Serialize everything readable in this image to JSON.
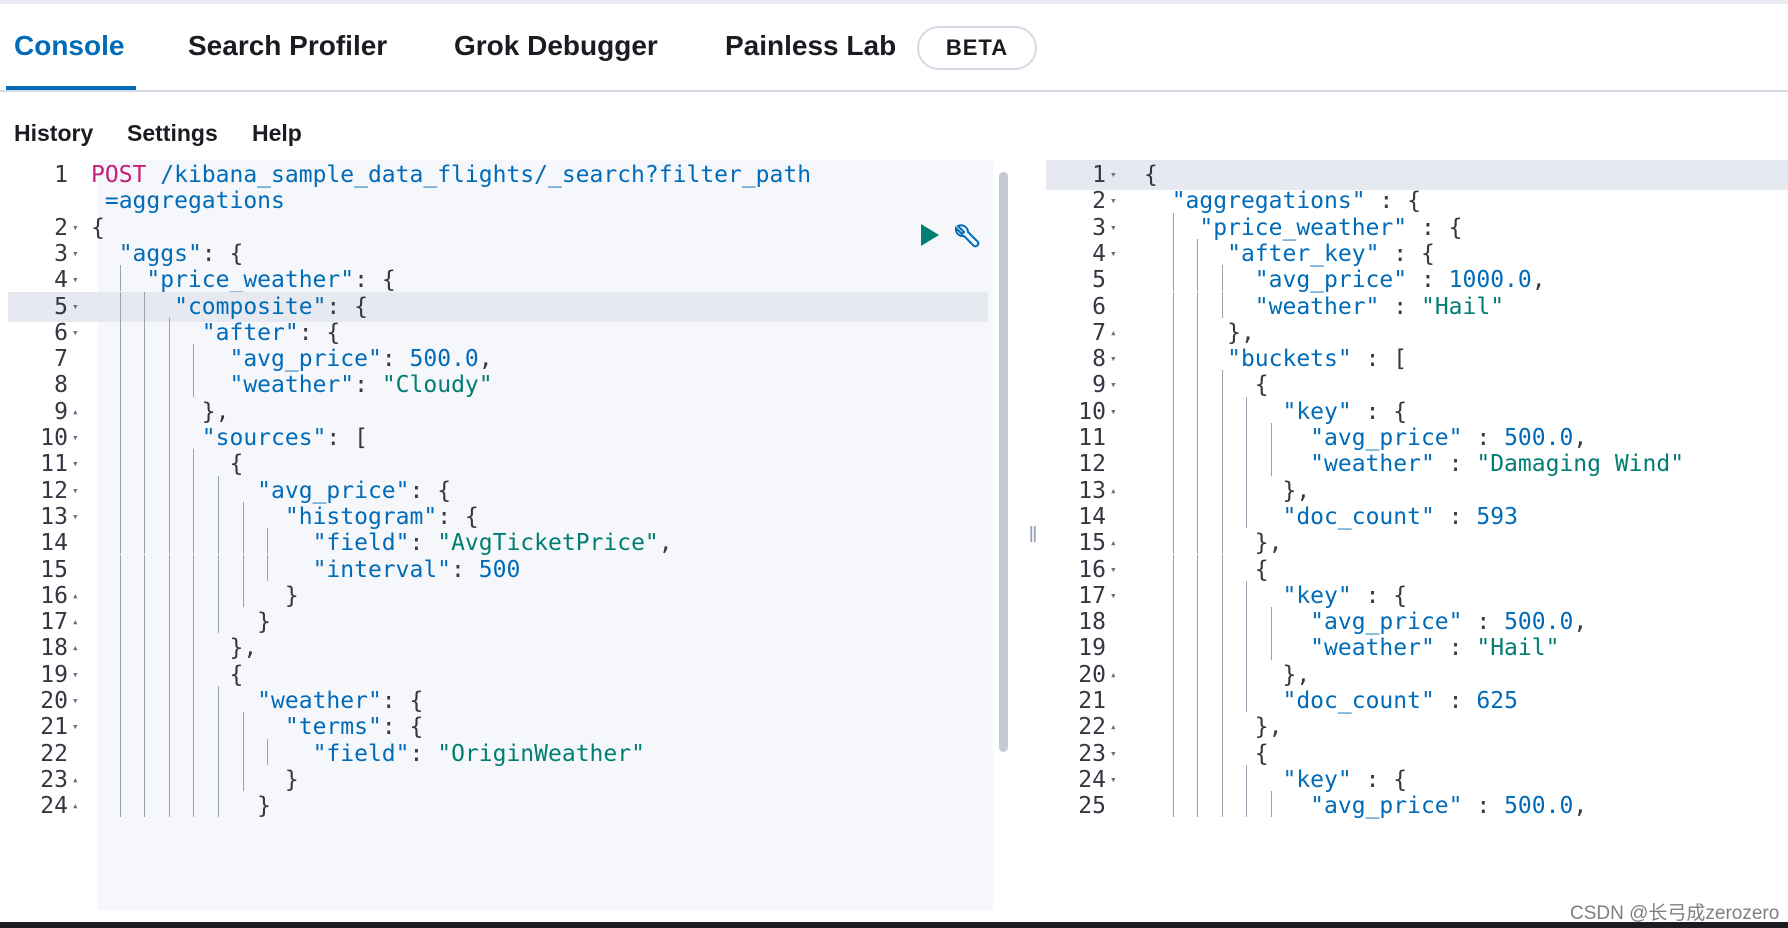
{
  "tabs": [
    {
      "label": "Console",
      "active": true
    },
    {
      "label": "Search Profiler"
    },
    {
      "label": "Grok Debugger"
    },
    {
      "label": "Painless Lab"
    }
  ],
  "beta_badge": "BETA",
  "menu": {
    "history": "History",
    "settings": "Settings",
    "help": "Help"
  },
  "icons": {
    "run": "play-icon",
    "settings": "wrench-icon",
    "resize": "drag-handle-icon"
  },
  "watermark": "CSDN @长弓成zerozero",
  "colors": {
    "accent": "#006bb8",
    "string": "#017d73",
    "method": "#c61e7a",
    "highlight": "#e6eaf0"
  },
  "request": {
    "highlighted_line": "5",
    "lines": [
      {
        "n": "1",
        "fold": "",
        "text": "POST /kibana_sample_data_flights/_search?filter_path"
      },
      {
        "n": "",
        "fold": "",
        "text": " =aggregations"
      },
      {
        "n": "2",
        "fold": "▾",
        "text": "{"
      },
      {
        "n": "3",
        "fold": "▾",
        "text": "  \"aggs\": {"
      },
      {
        "n": "4",
        "fold": "▾",
        "text": "    \"price_weather\": {"
      },
      {
        "n": "5",
        "fold": "▾",
        "text": "      \"composite\": {"
      },
      {
        "n": "6",
        "fold": "▾",
        "text": "        \"after\": {"
      },
      {
        "n": "7",
        "fold": "",
        "text": "          \"avg_price\": 500.0,"
      },
      {
        "n": "8",
        "fold": "",
        "text": "          \"weather\": \"Cloudy\""
      },
      {
        "n": "9",
        "fold": "▴",
        "text": "        },"
      },
      {
        "n": "10",
        "fold": "▾",
        "text": "        \"sources\": ["
      },
      {
        "n": "11",
        "fold": "▾",
        "text": "          {"
      },
      {
        "n": "12",
        "fold": "▾",
        "text": "            \"avg_price\": {"
      },
      {
        "n": "13",
        "fold": "▾",
        "text": "              \"histogram\": {"
      },
      {
        "n": "14",
        "fold": "",
        "text": "                \"field\": \"AvgTicketPrice\","
      },
      {
        "n": "15",
        "fold": "",
        "text": "                \"interval\": 500"
      },
      {
        "n": "16",
        "fold": "▴",
        "text": "              }"
      },
      {
        "n": "17",
        "fold": "▴",
        "text": "            }"
      },
      {
        "n": "18",
        "fold": "▴",
        "text": "          },"
      },
      {
        "n": "19",
        "fold": "▾",
        "text": "          {"
      },
      {
        "n": "20",
        "fold": "▾",
        "text": "            \"weather\": {"
      },
      {
        "n": "21",
        "fold": "▾",
        "text": "              \"terms\": {"
      },
      {
        "n": "22",
        "fold": "",
        "text": "                \"field\": \"OriginWeather\""
      },
      {
        "n": "23",
        "fold": "▴",
        "text": "              }"
      },
      {
        "n": "24",
        "fold": "▴",
        "text": "            }"
      }
    ]
  },
  "response": {
    "highlighted_line": "1",
    "lines": [
      {
        "n": "1",
        "fold": "▾",
        "text": "{"
      },
      {
        "n": "2",
        "fold": "▾",
        "text": "  \"aggregations\" : {"
      },
      {
        "n": "3",
        "fold": "▾",
        "text": "    \"price_weather\" : {"
      },
      {
        "n": "4",
        "fold": "▾",
        "text": "      \"after_key\" : {"
      },
      {
        "n": "5",
        "fold": "",
        "text": "        \"avg_price\" : 1000.0,"
      },
      {
        "n": "6",
        "fold": "",
        "text": "        \"weather\" : \"Hail\""
      },
      {
        "n": "7",
        "fold": "▴",
        "text": "      },"
      },
      {
        "n": "8",
        "fold": "▾",
        "text": "      \"buckets\" : ["
      },
      {
        "n": "9",
        "fold": "▾",
        "text": "        {"
      },
      {
        "n": "10",
        "fold": "▾",
        "text": "          \"key\" : {"
      },
      {
        "n": "11",
        "fold": "",
        "text": "            \"avg_price\" : 500.0,"
      },
      {
        "n": "12",
        "fold": "",
        "text": "            \"weather\" : \"Damaging Wind\""
      },
      {
        "n": "13",
        "fold": "▴",
        "text": "          },"
      },
      {
        "n": "14",
        "fold": "",
        "text": "          \"doc_count\" : 593"
      },
      {
        "n": "15",
        "fold": "▴",
        "text": "        },"
      },
      {
        "n": "16",
        "fold": "▾",
        "text": "        {"
      },
      {
        "n": "17",
        "fold": "▾",
        "text": "          \"key\" : {"
      },
      {
        "n": "18",
        "fold": "",
        "text": "            \"avg_price\" : 500.0,"
      },
      {
        "n": "19",
        "fold": "",
        "text": "            \"weather\" : \"Hail\""
      },
      {
        "n": "20",
        "fold": "▴",
        "text": "          },"
      },
      {
        "n": "21",
        "fold": "",
        "text": "          \"doc_count\" : 625"
      },
      {
        "n": "22",
        "fold": "▴",
        "text": "        },"
      },
      {
        "n": "23",
        "fold": "▾",
        "text": "        {"
      },
      {
        "n": "24",
        "fold": "▾",
        "text": "          \"key\" : {"
      },
      {
        "n": "25",
        "fold": "",
        "text": "            \"avg_price\" : 500.0,"
      }
    ]
  }
}
